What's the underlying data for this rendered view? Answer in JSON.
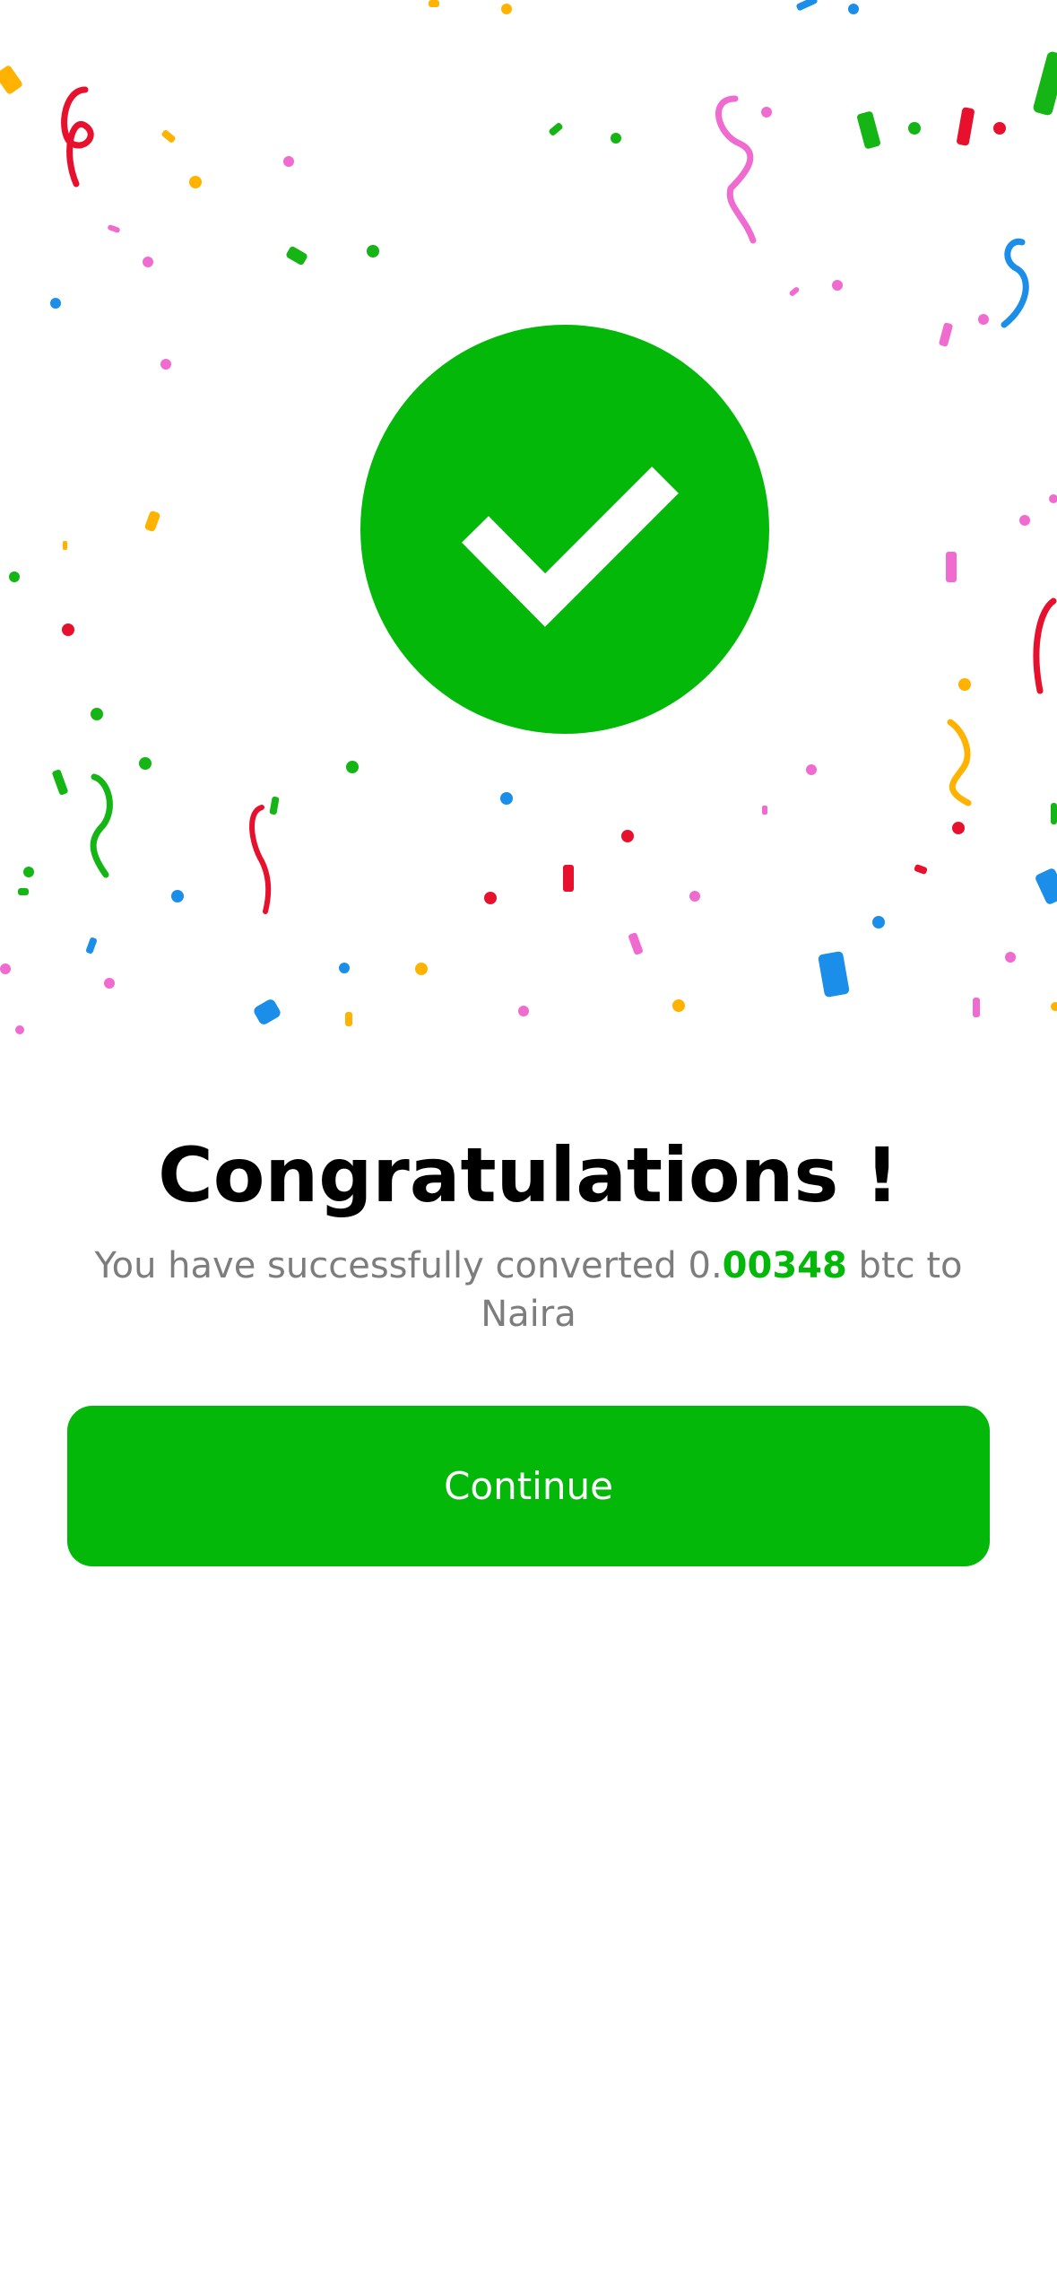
{
  "success": {
    "icon": "checkmark-icon",
    "color": "#04b80a"
  },
  "title": "Congratulations !",
  "message": {
    "prefix": "You have successfully converted 0.",
    "amount": "00348",
    "suffix": " btc to Naira"
  },
  "continue_button": {
    "label": "Continue"
  },
  "confetti_colors": [
    "#e8112d",
    "#f06bd0",
    "#15b515",
    "#ffb300",
    "#1a8ee8"
  ]
}
